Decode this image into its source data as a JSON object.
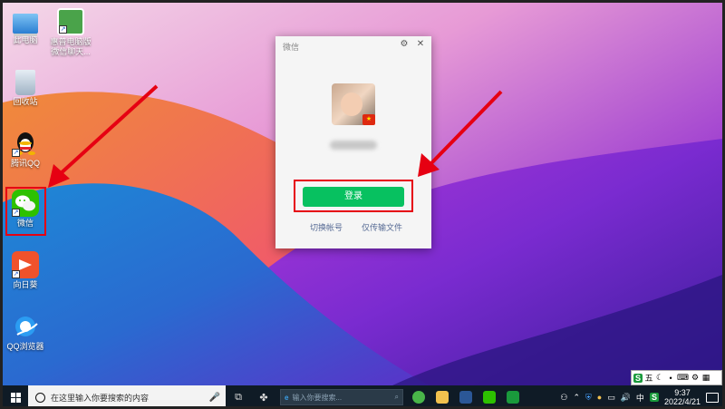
{
  "desktop": {
    "icons": [
      {
        "id": "pc",
        "label": "此电脑"
      },
      {
        "id": "app",
        "label": "惠普电脑版 微信聊天..."
      },
      {
        "id": "bin",
        "label": "回收站"
      },
      {
        "id": "qq",
        "label": "腾讯QQ"
      },
      {
        "id": "wechat",
        "label": "微信"
      },
      {
        "id": "video",
        "label": "向日葵"
      },
      {
        "id": "browser",
        "label": "QQ浏览器"
      }
    ]
  },
  "wechat_dialog": {
    "title": "微信",
    "login_label": "登录",
    "switch_account_label": "切换帐号",
    "file_transfer_only_label": "仅传输文件",
    "flag_glyph": "★"
  },
  "ime_bar": {
    "items": [
      "S",
      "五",
      "☾",
      "•",
      "⌨",
      "⚙",
      "▦"
    ]
  },
  "taskbar": {
    "search_placeholder": "在这里输入你要搜索的内容",
    "edge_search_placeholder": "输入你要搜索...",
    "tray": {
      "lang": "中",
      "ime_glyph": "S",
      "time": "9:37",
      "date": "2022/4/21"
    }
  },
  "colors": {
    "wechat_green": "#07c160",
    "highlight_red": "#e60012",
    "taskbar": "#0f1b26"
  }
}
